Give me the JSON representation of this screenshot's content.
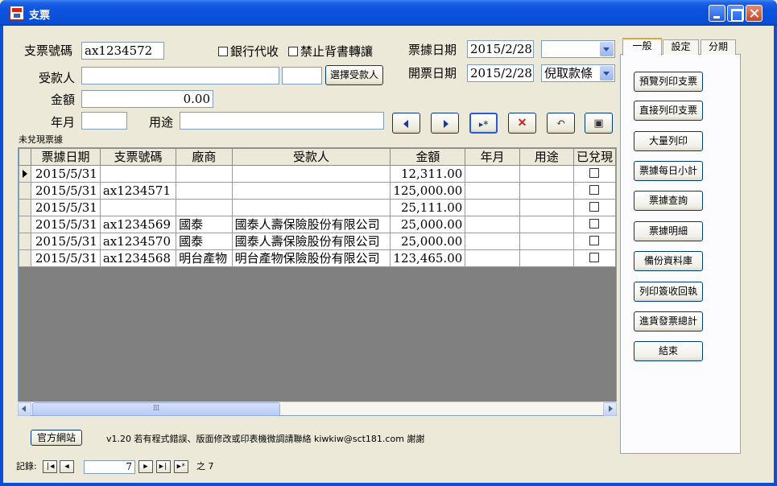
{
  "window": {
    "title": "支票"
  },
  "form": {
    "check_no_label": "支票號碼",
    "check_no_value": "ax1234572",
    "bank_collect_label": "銀行代收",
    "no_endorse_label": "禁止背書轉讓",
    "payee_label": "受款人",
    "payee_value": "",
    "payee_code_value": "",
    "select_payee_button": "選擇受款人",
    "amount_label": "金額",
    "amount_value": "0.00",
    "yearmonth_label": "年月",
    "yearmonth_value": "",
    "purpose_label": "用途",
    "purpose_value": "",
    "bill_date_label": "票據日期",
    "bill_date_value": "2015/2/28",
    "bill_date_combo": "",
    "issue_date_label": "開票日期",
    "issue_date_value": "2015/2/28",
    "issue_mode_combo": "倪取款條"
  },
  "grid": {
    "caption": "未兌現票據",
    "columns": [
      "票據日期",
      "支票號碼",
      "廠商",
      "受款人",
      "金額",
      "年月",
      "用途",
      "已兌現"
    ],
    "rows": [
      {
        "date": "2015/5/31",
        "check_no": "",
        "vendor": "",
        "payee": "",
        "amount": "12,311.00",
        "ym": "",
        "purpose": "",
        "cashed": false
      },
      {
        "date": "2015/5/31",
        "check_no": "ax1234571",
        "vendor": "",
        "payee": "",
        "amount": "125,000.00",
        "ym": "",
        "purpose": "",
        "cashed": false
      },
      {
        "date": "2015/5/31",
        "check_no": "",
        "vendor": "",
        "payee": "",
        "amount": "25,111.00",
        "ym": "",
        "purpose": "",
        "cashed": false
      },
      {
        "date": "2015/5/31",
        "check_no": "ax1234569",
        "vendor": "國泰",
        "payee": "國泰人壽保險股份有限公司",
        "amount": "25,000.00",
        "ym": "",
        "purpose": "",
        "cashed": false
      },
      {
        "date": "2015/5/31",
        "check_no": "ax1234570",
        "vendor": "國泰",
        "payee": "國泰人壽保險股份有限公司",
        "amount": "25,000.00",
        "ym": "",
        "purpose": "",
        "cashed": false
      },
      {
        "date": "2015/5/31",
        "check_no": "ax1234568",
        "vendor": "明台產物",
        "payee": "明台產物保險股份有限公司",
        "amount": "123,465.00",
        "ym": "",
        "purpose": "",
        "cashed": false
      }
    ]
  },
  "tabs": [
    "一般",
    "設定",
    "分期"
  ],
  "side_buttons": [
    "預覽列印支票",
    "直接列印支票",
    "大量列印",
    "票據每日小計",
    "票據查詢",
    "票據明細",
    "備份資料庫",
    "列印簽收回執",
    "進貨發票總計",
    "結束"
  ],
  "footer": {
    "website_button": "官方網站",
    "notice": "v1.20 若有程式錯誤、版面修改或印表機微調請聯絡 kiwkiw@sct181.com 謝謝",
    "record_label": "記錄:",
    "record_current": "7",
    "record_of": "之 7"
  },
  "icons": {
    "nav": [
      "prev-icon",
      "next-icon",
      "new-record-icon",
      "delete-icon",
      "undo-icon",
      "save-icon"
    ],
    "scroll_grip": "Ⅲ"
  }
}
